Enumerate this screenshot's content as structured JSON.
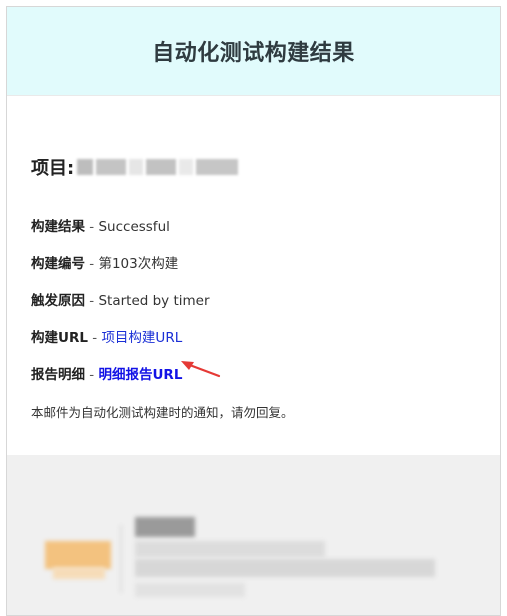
{
  "header": {
    "title": "自动化测试构建结果"
  },
  "project": {
    "label": "项目:"
  },
  "details": [
    {
      "key": "构建结果",
      "sep": " - ",
      "value": "Successful"
    },
    {
      "key": "构建编号",
      "sep": " - ",
      "value": "第103次构建"
    },
    {
      "key": "触发原因",
      "sep": " - ",
      "value": "Started by timer"
    },
    {
      "key": "构建URL",
      "sep": " - ",
      "value": "项目构建URL"
    },
    {
      "key": "报告明细",
      "sep": " - ",
      "value": "明细报告URL"
    }
  ],
  "notice": "本邮件为自动化测试构建时的通知，请勿回复。",
  "colors": {
    "header_bg": "#e1fbfc",
    "link": "#1a2fd6",
    "annotation_arrow": "#e53935",
    "footer_bg": "#f0f0f0"
  }
}
